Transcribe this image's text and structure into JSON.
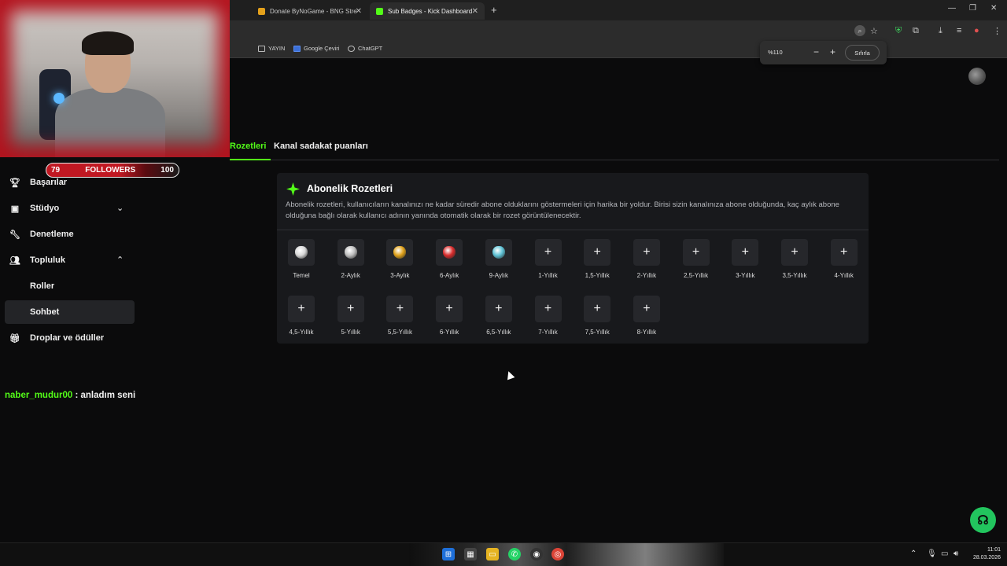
{
  "browser": {
    "tabs": [
      {
        "label": "Donate ByNoGame - BNG Stre",
        "active": false
      },
      {
        "label": "Sub Badges - Kick Dashboard",
        "active": true
      }
    ],
    "bookmarks": [
      "YAYIN",
      "Google Çeviri",
      "ChatGPT"
    ],
    "zoom": {
      "value": "%110",
      "reset_label": "Sıfırla",
      "minus": "−",
      "plus": "+"
    }
  },
  "overlay": {
    "followers_label": "FOLLOWERS",
    "followers_current": "79",
    "followers_goal": "100"
  },
  "sidebar": {
    "items": [
      {
        "label": "Başarılar",
        "icon": "trophy-icon"
      },
      {
        "label": "Stüdyo",
        "icon": "studio-icon"
      },
      {
        "label": "Denetleme",
        "icon": "wrench-icon"
      },
      {
        "label": "Topluluk",
        "icon": "people-icon"
      },
      {
        "label": "Droplar ve ödüller",
        "icon": "gift-icon"
      }
    ],
    "sub_items": [
      "Roller",
      "Sohbet"
    ],
    "active_sub": "Sohbet"
  },
  "chat": {
    "user": "naber_mudur00",
    "message": " : anladım seni"
  },
  "page_tabs": {
    "active_partial": "Rozetleri",
    "other": "Kanal sadakat puanları"
  },
  "card": {
    "title": "Abonelik Rozetleri",
    "description": "Abonelik rozetleri, kullanıcıların kanalınızı ne kadar süredir abone olduklarını göstermeleri için harika bir yoldur. Birisi sizin kanalınıza abone olduğunda, kaç aylık abone olduğuna bağlı olarak kullanıcı adının yanında otomatik olarak bir rozet görüntülenecektir.",
    "badges": [
      {
        "label": "Temel",
        "type": "gem",
        "color": "#d8d8d8"
      },
      {
        "label": "2-Aylık",
        "type": "gem",
        "color": "#bfbfbf"
      },
      {
        "label": "3-Aylık",
        "type": "gem",
        "color": "#e0a21a"
      },
      {
        "label": "6-Aylık",
        "type": "gem",
        "color": "#d92c2c"
      },
      {
        "label": "9-Aylık",
        "type": "gem",
        "color": "#5fc3d6"
      },
      {
        "label": "1-Yıllık",
        "type": "add"
      },
      {
        "label": "1,5-Yıllık",
        "type": "add"
      },
      {
        "label": "2-Yıllık",
        "type": "add"
      },
      {
        "label": "2,5-Yıllık",
        "type": "add"
      },
      {
        "label": "3-Yıllık",
        "type": "add"
      },
      {
        "label": "3,5-Yıllık",
        "type": "add"
      },
      {
        "label": "4-Yıllık",
        "type": "add"
      },
      {
        "label": "4,5-Yıllık",
        "type": "add"
      },
      {
        "label": "5-Yıllık",
        "type": "add"
      },
      {
        "label": "5,5-Yıllık",
        "type": "add"
      },
      {
        "label": "6-Yıllık",
        "type": "add"
      },
      {
        "label": "6,5-Yıllık",
        "type": "add"
      },
      {
        "label": "7-Yıllık",
        "type": "add"
      },
      {
        "label": "7,5-Yıllık",
        "type": "add"
      },
      {
        "label": "8-Yıllık",
        "type": "add"
      }
    ],
    "add_symbol": "+"
  },
  "taskbar": {
    "time": "11:01",
    "date": "28.03.2026"
  },
  "colors": {
    "accent": "#53fc18",
    "help": "#22c55e",
    "overlay_red": "#c01822"
  }
}
